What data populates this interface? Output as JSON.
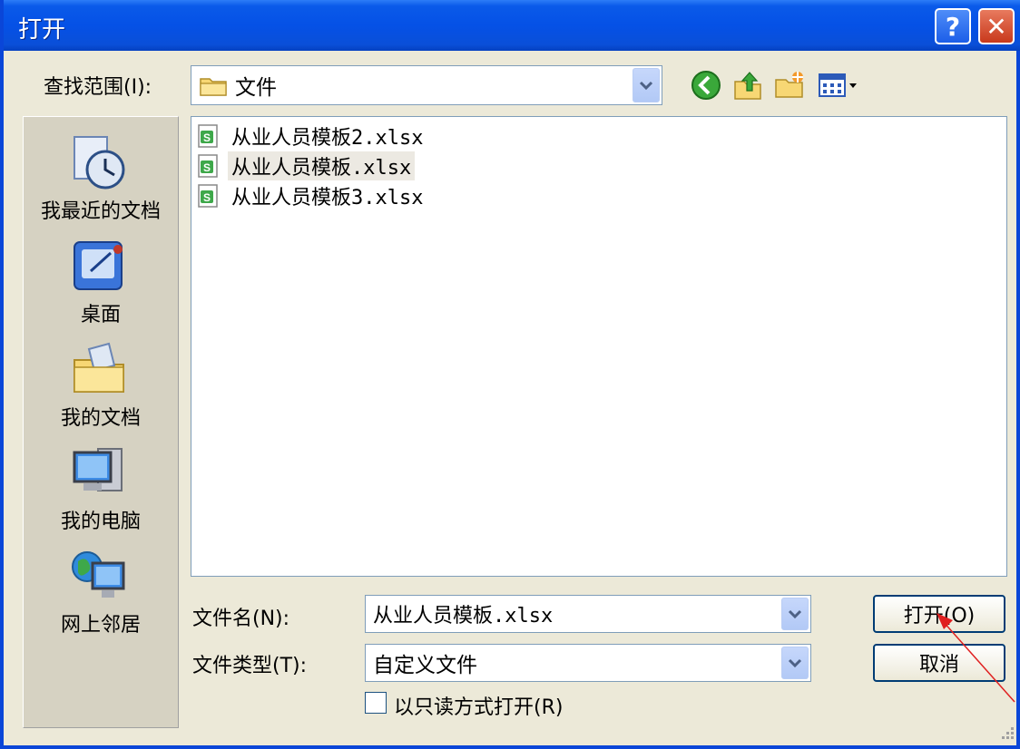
{
  "window": {
    "title": "打开"
  },
  "lookin": {
    "label": "查找范围(I):",
    "value": "文件"
  },
  "places": [
    {
      "label": "我最近的文档",
      "icon": "recent-documents-icon"
    },
    {
      "label": "桌面",
      "icon": "desktop-icon"
    },
    {
      "label": "我的文档",
      "icon": "my-documents-icon"
    },
    {
      "label": "我的电脑",
      "icon": "my-computer-icon"
    },
    {
      "label": "网上邻居",
      "icon": "network-places-icon"
    }
  ],
  "files": [
    {
      "name": "从业人员模板2.xlsx",
      "selected": false
    },
    {
      "name": "从业人员模板.xlsx",
      "selected": true
    },
    {
      "name": "从业人员模板3.xlsx",
      "selected": false
    }
  ],
  "filename": {
    "label": "文件名(N):",
    "value": "从业人员模板.xlsx"
  },
  "filetype": {
    "label": "文件类型(T):",
    "value": "自定义文件"
  },
  "readonly": {
    "label": "以只读方式打开(R)",
    "checked": false
  },
  "buttons": {
    "open": "打开(O)",
    "cancel": "取消"
  },
  "colors": {
    "titlebar": "#0551e6",
    "dialog_bg": "#ece9d8",
    "border": "#0a46d8",
    "annotation_arrow": "#e02020"
  }
}
